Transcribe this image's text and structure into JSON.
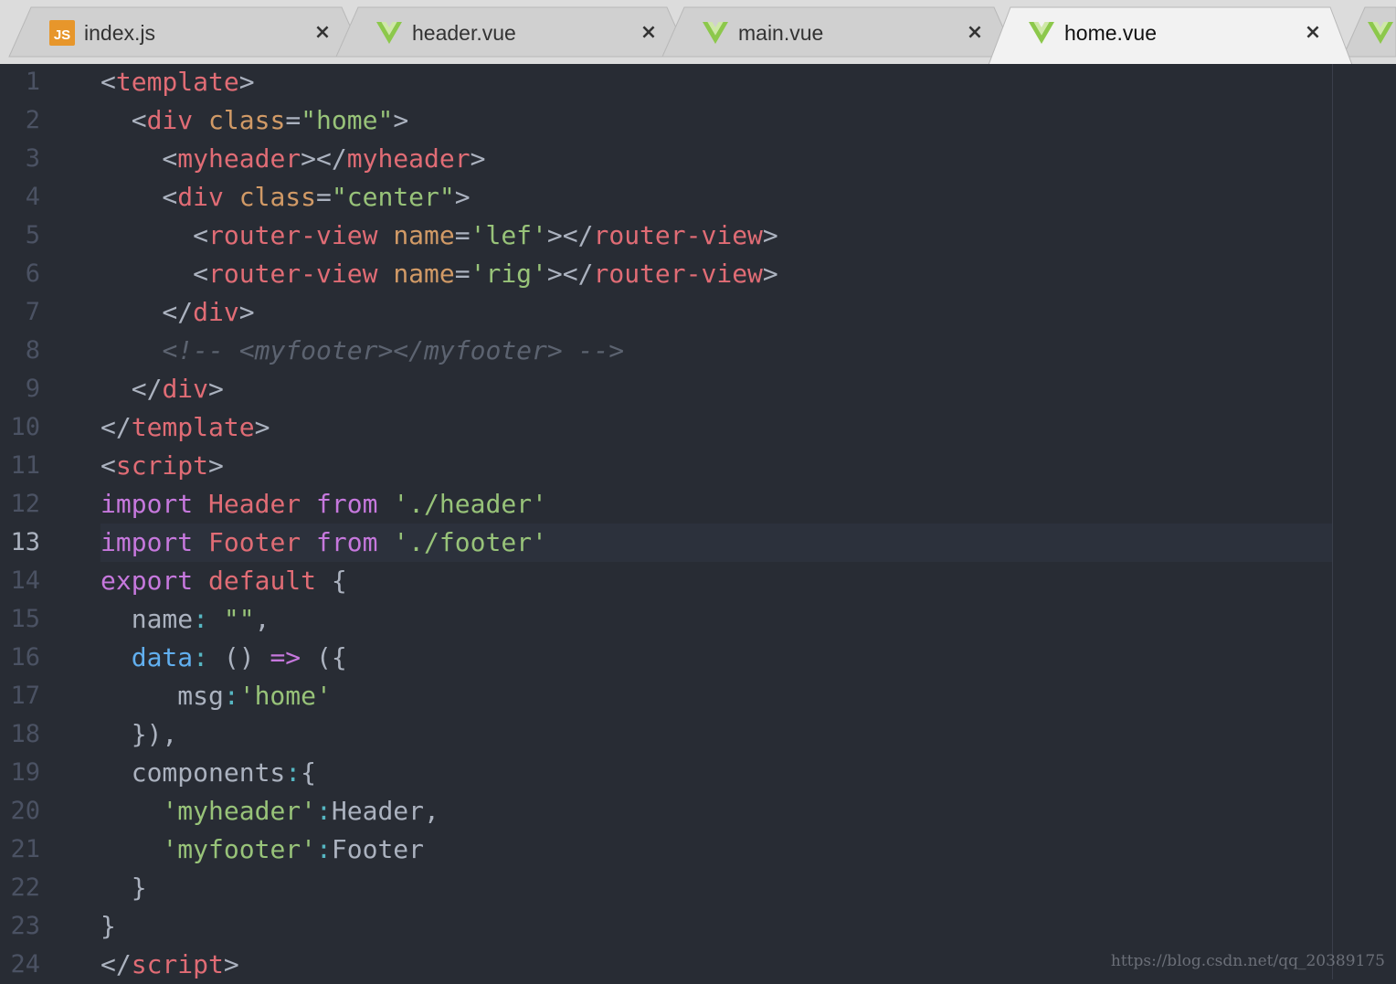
{
  "tabs": [
    {
      "label": "index.js",
      "icon": "js-file-icon",
      "active": false
    },
    {
      "label": "header.vue",
      "icon": "vue-file-icon",
      "active": false
    },
    {
      "label": "main.vue",
      "icon": "vue-file-icon",
      "active": false
    },
    {
      "label": "home.vue",
      "icon": "vue-file-icon",
      "active": true
    }
  ],
  "tab_overflow_icon": "vue-file-icon",
  "close_glyph": "×",
  "js_badge": "JS",
  "editor": {
    "current_line": 13,
    "line_numbers": [
      "1",
      "2",
      "3",
      "4",
      "5",
      "6",
      "7",
      "8",
      "9",
      "10",
      "11",
      "12",
      "13",
      "14",
      "15",
      "16",
      "17",
      "18",
      "19",
      "20",
      "21",
      "22",
      "23",
      "24"
    ],
    "lines": [
      [
        [
          "pu",
          "<"
        ],
        [
          "tg",
          "template"
        ],
        [
          "pu",
          ">"
        ]
      ],
      [
        [
          "pu",
          "  <"
        ],
        [
          "tg",
          "div"
        ],
        [
          "pu",
          " "
        ],
        [
          "at",
          "class"
        ],
        [
          "pu",
          "="
        ],
        [
          "st",
          "\"home\""
        ],
        [
          "pu",
          ">"
        ]
      ],
      [
        [
          "pu",
          "    <"
        ],
        [
          "tg",
          "myheader"
        ],
        [
          "pu",
          "></"
        ],
        [
          "tg",
          "myheader"
        ],
        [
          "pu",
          ">"
        ]
      ],
      [
        [
          "pu",
          "    <"
        ],
        [
          "tg",
          "div"
        ],
        [
          "pu",
          " "
        ],
        [
          "at",
          "class"
        ],
        [
          "pu",
          "="
        ],
        [
          "st",
          "\"center\""
        ],
        [
          "pu",
          ">"
        ]
      ],
      [
        [
          "pu",
          "      <"
        ],
        [
          "tg",
          "router-view"
        ],
        [
          "pu",
          " "
        ],
        [
          "at",
          "name"
        ],
        [
          "pu",
          "="
        ],
        [
          "st",
          "'lef'"
        ],
        [
          "pu",
          "></"
        ],
        [
          "tg",
          "router-view"
        ],
        [
          "pu",
          ">"
        ]
      ],
      [
        [
          "pu",
          "      <"
        ],
        [
          "tg",
          "router-view"
        ],
        [
          "pu",
          " "
        ],
        [
          "at",
          "name"
        ],
        [
          "pu",
          "="
        ],
        [
          "st",
          "'rig'"
        ],
        [
          "pu",
          "></"
        ],
        [
          "tg",
          "router-view"
        ],
        [
          "pu",
          ">"
        ]
      ],
      [
        [
          "pu",
          "    </"
        ],
        [
          "tg",
          "div"
        ],
        [
          "pu",
          ">"
        ]
      ],
      [
        [
          "pu",
          "    "
        ],
        [
          "cm",
          "<!-- <myfooter></myfooter> -->"
        ]
      ],
      [
        [
          "pu",
          "  </"
        ],
        [
          "tg",
          "div"
        ],
        [
          "pu",
          ">"
        ]
      ],
      [
        [
          "pu",
          "</"
        ],
        [
          "tg",
          "template"
        ],
        [
          "pu",
          ">"
        ]
      ],
      [
        [
          "pu",
          "<"
        ],
        [
          "tg",
          "script"
        ],
        [
          "pu",
          ">"
        ]
      ],
      [
        [
          "kw",
          "import"
        ],
        [
          "pu",
          " "
        ],
        [
          "tg",
          "Header"
        ],
        [
          "pu",
          " "
        ],
        [
          "kw",
          "from"
        ],
        [
          "pu",
          " "
        ],
        [
          "st",
          "'./header'"
        ]
      ],
      [
        [
          "kw",
          "import"
        ],
        [
          "pu",
          " "
        ],
        [
          "tg",
          "Footer"
        ],
        [
          "pu",
          " "
        ],
        [
          "kw",
          "from"
        ],
        [
          "pu",
          " "
        ],
        [
          "st",
          "'./footer'"
        ]
      ],
      [
        [
          "kw",
          "export"
        ],
        [
          "pu",
          " "
        ],
        [
          "tg",
          "default"
        ],
        [
          "pu",
          " {"
        ]
      ],
      [
        [
          "pu",
          "  name"
        ],
        [
          "op",
          ":"
        ],
        [
          "pu",
          " "
        ],
        [
          "st",
          "\"\""
        ],
        [
          "pu",
          ","
        ]
      ],
      [
        [
          "pu",
          "  "
        ],
        [
          "fn",
          "data"
        ],
        [
          "op",
          ":"
        ],
        [
          "pu",
          " () "
        ],
        [
          "kw",
          "=>"
        ],
        [
          "pu",
          " ({"
        ]
      ],
      [
        [
          "pu",
          "     msg"
        ],
        [
          "op",
          ":"
        ],
        [
          "st",
          "'home'"
        ]
      ],
      [
        [
          "pu",
          "  }),"
        ]
      ],
      [
        [
          "pu",
          "  components"
        ],
        [
          "op",
          ":"
        ],
        [
          "pu",
          "{"
        ]
      ],
      [
        [
          "pu",
          "    "
        ],
        [
          "st",
          "'myheader'"
        ],
        [
          "op",
          ":"
        ],
        [
          "pu",
          "Header,"
        ]
      ],
      [
        [
          "pu",
          "    "
        ],
        [
          "st",
          "'myfooter'"
        ],
        [
          "op",
          ":"
        ],
        [
          "pu",
          "Footer"
        ]
      ],
      [
        [
          "pu",
          "  }"
        ]
      ],
      [
        [
          "pu",
          "}"
        ]
      ],
      [
        [
          "pu",
          "</"
        ],
        [
          "tg",
          "script"
        ],
        [
          "pu",
          ">"
        ]
      ]
    ]
  },
  "watermark": "https://blog.csdn.net/qq_20389175",
  "colors": {
    "background": "#282c34",
    "tag": "#e06c75",
    "attribute": "#d19a66",
    "string": "#98c379",
    "keyword": "#c678dd",
    "function": "#61afef",
    "comment": "#5c6370",
    "vue_icon": "#8cc84b",
    "js_icon": "#e7962b"
  }
}
